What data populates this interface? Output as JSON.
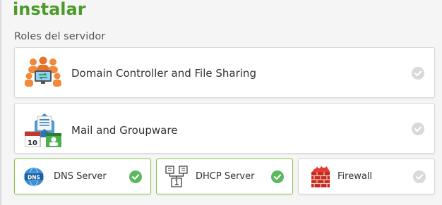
{
  "header": {
    "title": "instalar"
  },
  "section": {
    "label": "Roles del servidor"
  },
  "roles": [
    {
      "label": "Domain Controller and File Sharing",
      "selected": false
    },
    {
      "label": "Mail and Groupware",
      "selected": false
    },
    {
      "label": "DNS Server",
      "selected": true
    },
    {
      "label": "DHCP Server",
      "selected": true
    },
    {
      "label": "Firewall",
      "selected": false
    }
  ],
  "icon_text": {
    "dns": "DNS",
    "mail_calendar": "10"
  },
  "colors": {
    "title_green": "#4c9a2a",
    "check_active": "#5cb85c",
    "check_inactive": "#d9d9d9",
    "selected_border": "#8bc34a"
  }
}
